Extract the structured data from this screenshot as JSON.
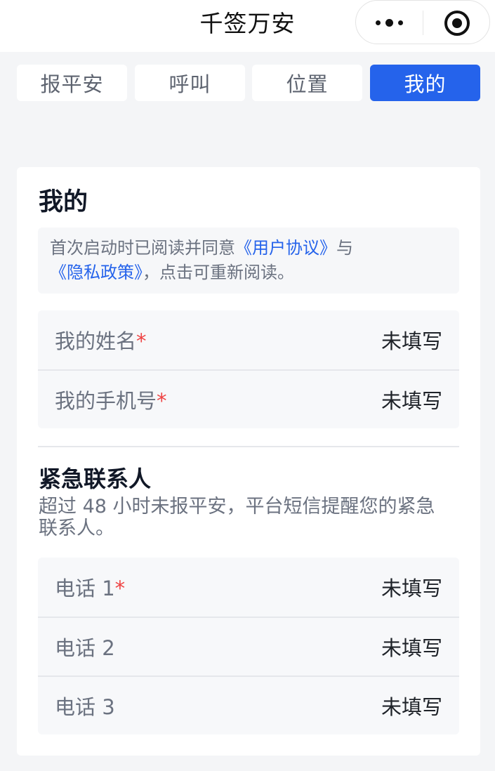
{
  "navbar": {
    "title": "千签万安",
    "more_icon": "more-dots-icon",
    "close_icon": "target-icon"
  },
  "tabs": [
    {
      "label": "报平安",
      "active": false
    },
    {
      "label": "呼叫",
      "active": false
    },
    {
      "label": "位置",
      "active": false
    },
    {
      "label": "我的",
      "active": true
    }
  ],
  "profile": {
    "title": "我的",
    "notice": {
      "prefix": "首次启动时已阅读并同意",
      "user_agreement": "《用户协议》",
      "conjunction": "与",
      "privacy_policy": "《隐私政策》",
      "suffix": "，点击可重新阅读。"
    },
    "fields": [
      {
        "label": "我的姓名",
        "required_mark": "*",
        "value": "未填写"
      },
      {
        "label": "我的手机号",
        "required_mark": "*",
        "value": "未填写"
      }
    ]
  },
  "emergency": {
    "title": "紧急联系人",
    "description": "超过 48 小时未报平安，平台短信提醒您的紧急联系人。",
    "contacts": [
      {
        "label": "电话 1",
        "required_mark": "*",
        "value": "未填写"
      },
      {
        "label": "电话 2",
        "required_mark": "",
        "value": "未填写"
      },
      {
        "label": "电话 3",
        "required_mark": "",
        "value": "未填写"
      }
    ]
  },
  "colors": {
    "accent": "#2563eb",
    "required": "#ef4444",
    "background": "#f4f5f7"
  }
}
